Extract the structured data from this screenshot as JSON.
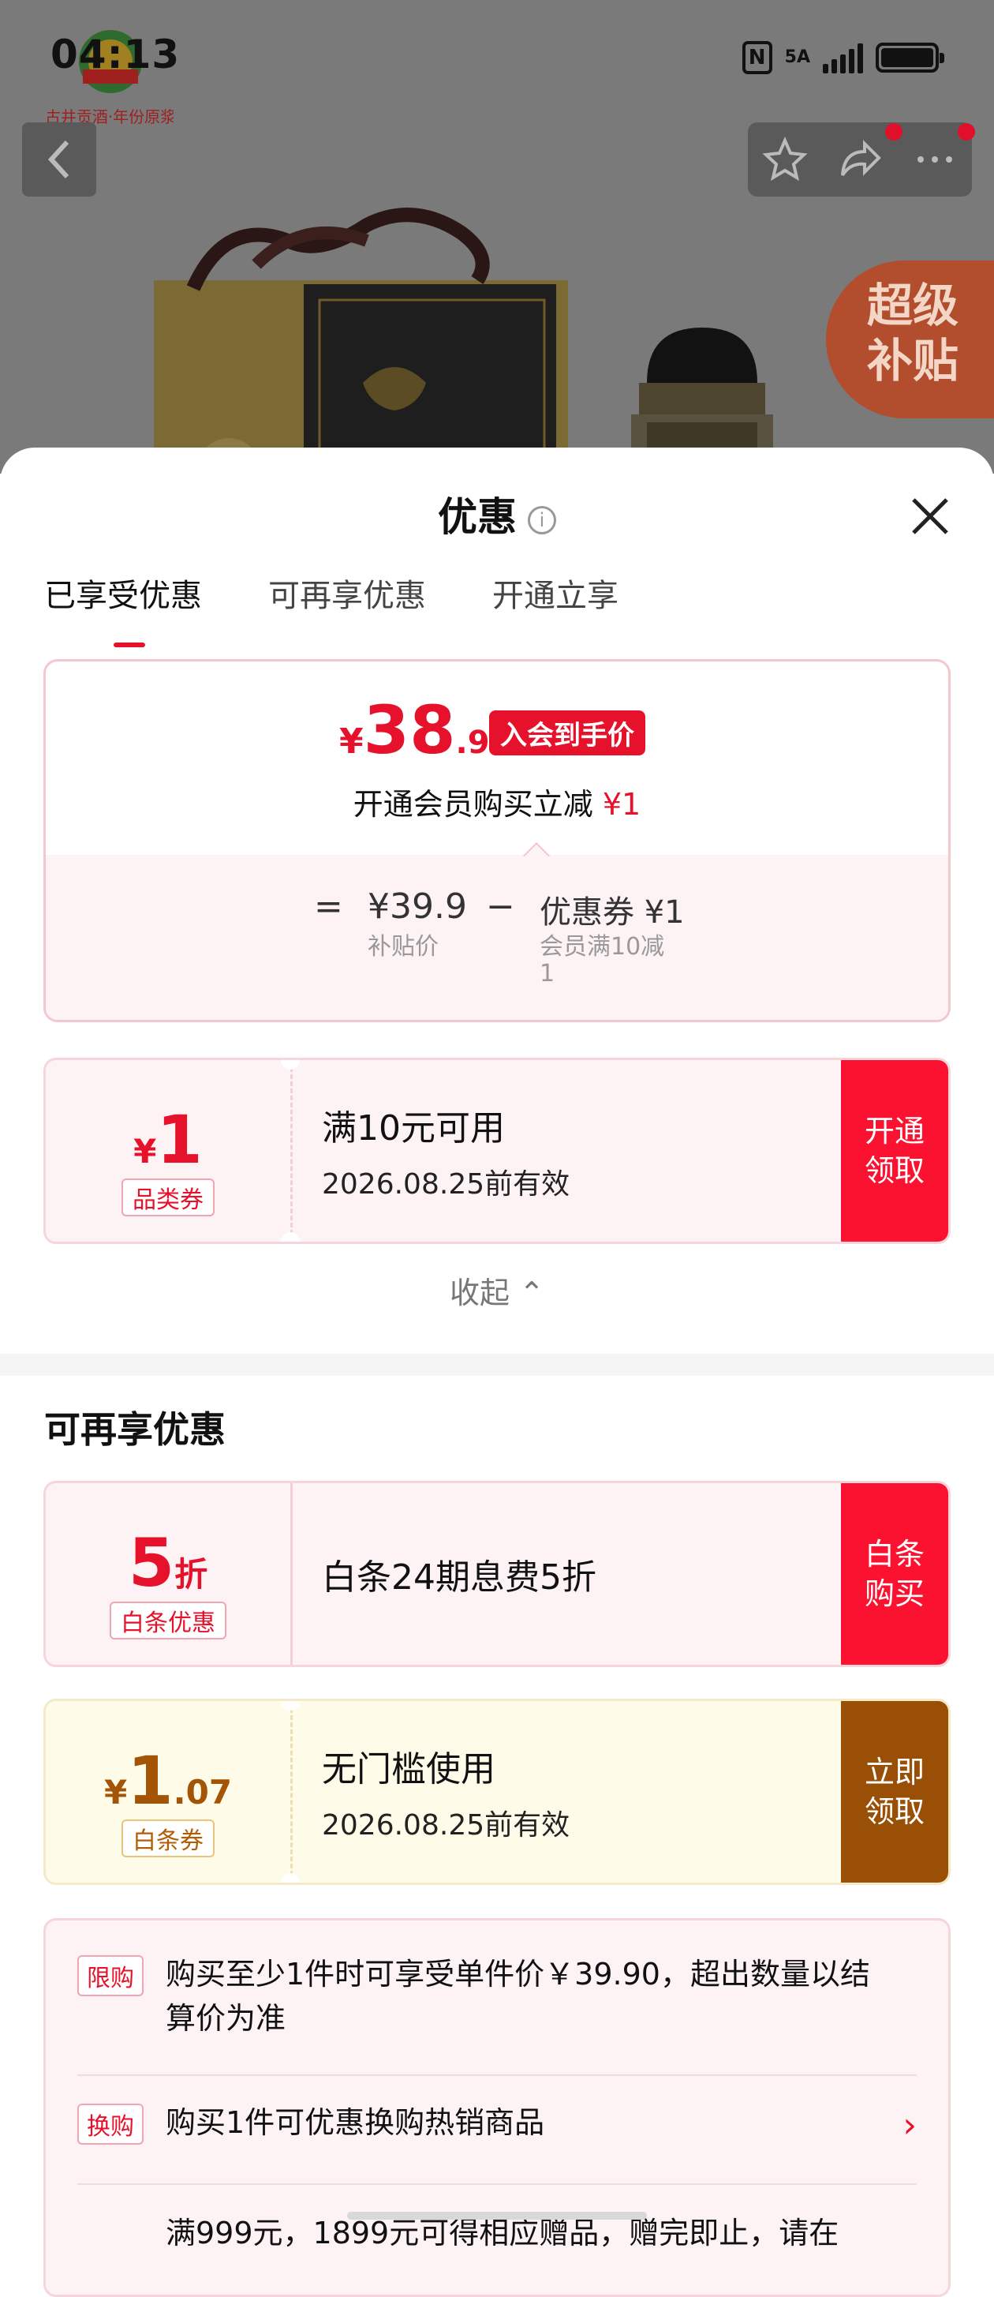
{
  "status_bar": {
    "time": "04:13",
    "network": "5A"
  },
  "brand": {
    "logo_text": "古井贡酒·年份原浆"
  },
  "banner": {
    "badge_line1": "超级",
    "badge_line2": "补贴"
  },
  "sheet": {
    "title": "优惠",
    "info_icon": "i",
    "tabs": [
      {
        "label": "已享受优惠",
        "active": true
      },
      {
        "label": "可再享优惠",
        "active": false
      },
      {
        "label": "开通立享",
        "active": false
      }
    ],
    "price_card": {
      "currency": "¥",
      "price_int": "38",
      "price_dec": ".9",
      "badge": "入会到手价",
      "member_text": "开通会员购买立减",
      "member_amount": "¥1",
      "eq": "=",
      "subsidy_price": "¥39.9",
      "subsidy_label": "补贴价",
      "minus": "−",
      "coupon_label": "优惠券 ¥1",
      "coupon_desc_1": "会员满10减",
      "coupon_desc_2": "1"
    },
    "category_coupon": {
      "currency": "¥",
      "amount": "1",
      "tag": "品类券",
      "title": "满10元可用",
      "valid": "2026.08.25前有效",
      "action_1": "开通",
      "action_2": "领取"
    },
    "collapse_label": "收起",
    "more_title": "可再享优惠",
    "baitiao_discount": {
      "amount": "5",
      "unit": "折",
      "tag": "白条优惠",
      "title": "白条24期息费5折",
      "action_1": "白条",
      "action_2": "购买"
    },
    "baitiao_coupon": {
      "currency": "¥",
      "amount": "1",
      "dec": ".07",
      "tag": "白条券",
      "title": "无门槛使用",
      "valid": "2026.08.25前有效",
      "action_1": "立即",
      "action_2": "领取"
    },
    "rules": [
      {
        "tag": "限购",
        "text": "购买至少1件时可享受单件价￥39.90，超出数量以结算价为准"
      },
      {
        "tag": "换购",
        "text": "购买1件可优惠换购热销商品"
      },
      {
        "tag": "",
        "text": "满999元，1899元可得相应赠品，赠完即止，请在"
      }
    ]
  },
  "colors": {
    "accent": "#e6122b",
    "action_red": "#fb1231",
    "action_brown": "#9a4f06"
  }
}
